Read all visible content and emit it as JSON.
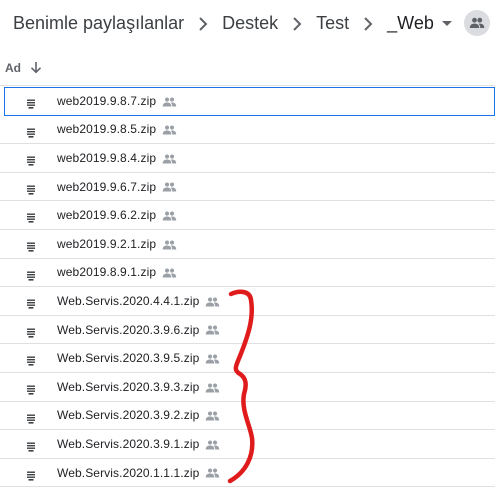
{
  "breadcrumb": {
    "items": [
      "Benimle paylaşılanlar",
      "Destek",
      "Test",
      "_Web"
    ],
    "shared_icon": "people-icon",
    "dropdown_icon": "caret-down-icon"
  },
  "list_header": {
    "sort_label": "Ad",
    "sort_icon": "arrow-down-icon"
  },
  "files": [
    {
      "name": "web2019.9.8.7.zip",
      "selected": true
    },
    {
      "name": "web2019.9.8.5.zip"
    },
    {
      "name": "web2019.9.8.4.zip"
    },
    {
      "name": "web2019.9.6.7.zip"
    },
    {
      "name": "web2019.9.6.2.zip"
    },
    {
      "name": "web2019.9.2.1.zip"
    },
    {
      "name": "web2019.8.9.1.zip"
    },
    {
      "name": "Web.Servis.2020.4.4.1.zip"
    },
    {
      "name": "Web.Servis.2020.3.9.6.zip"
    },
    {
      "name": "Web.Servis.2020.3.9.5.zip"
    },
    {
      "name": "Web.Servis.2020.3.9.3.zip"
    },
    {
      "name": "Web.Servis.2020.3.9.2.zip"
    },
    {
      "name": "Web.Servis.2020.3.9.1.zip"
    },
    {
      "name": "Web.Servis.2020.1.1.1.zip"
    }
  ],
  "colors": {
    "annotation": "#e01b1b",
    "selection": "#1a73e8"
  }
}
